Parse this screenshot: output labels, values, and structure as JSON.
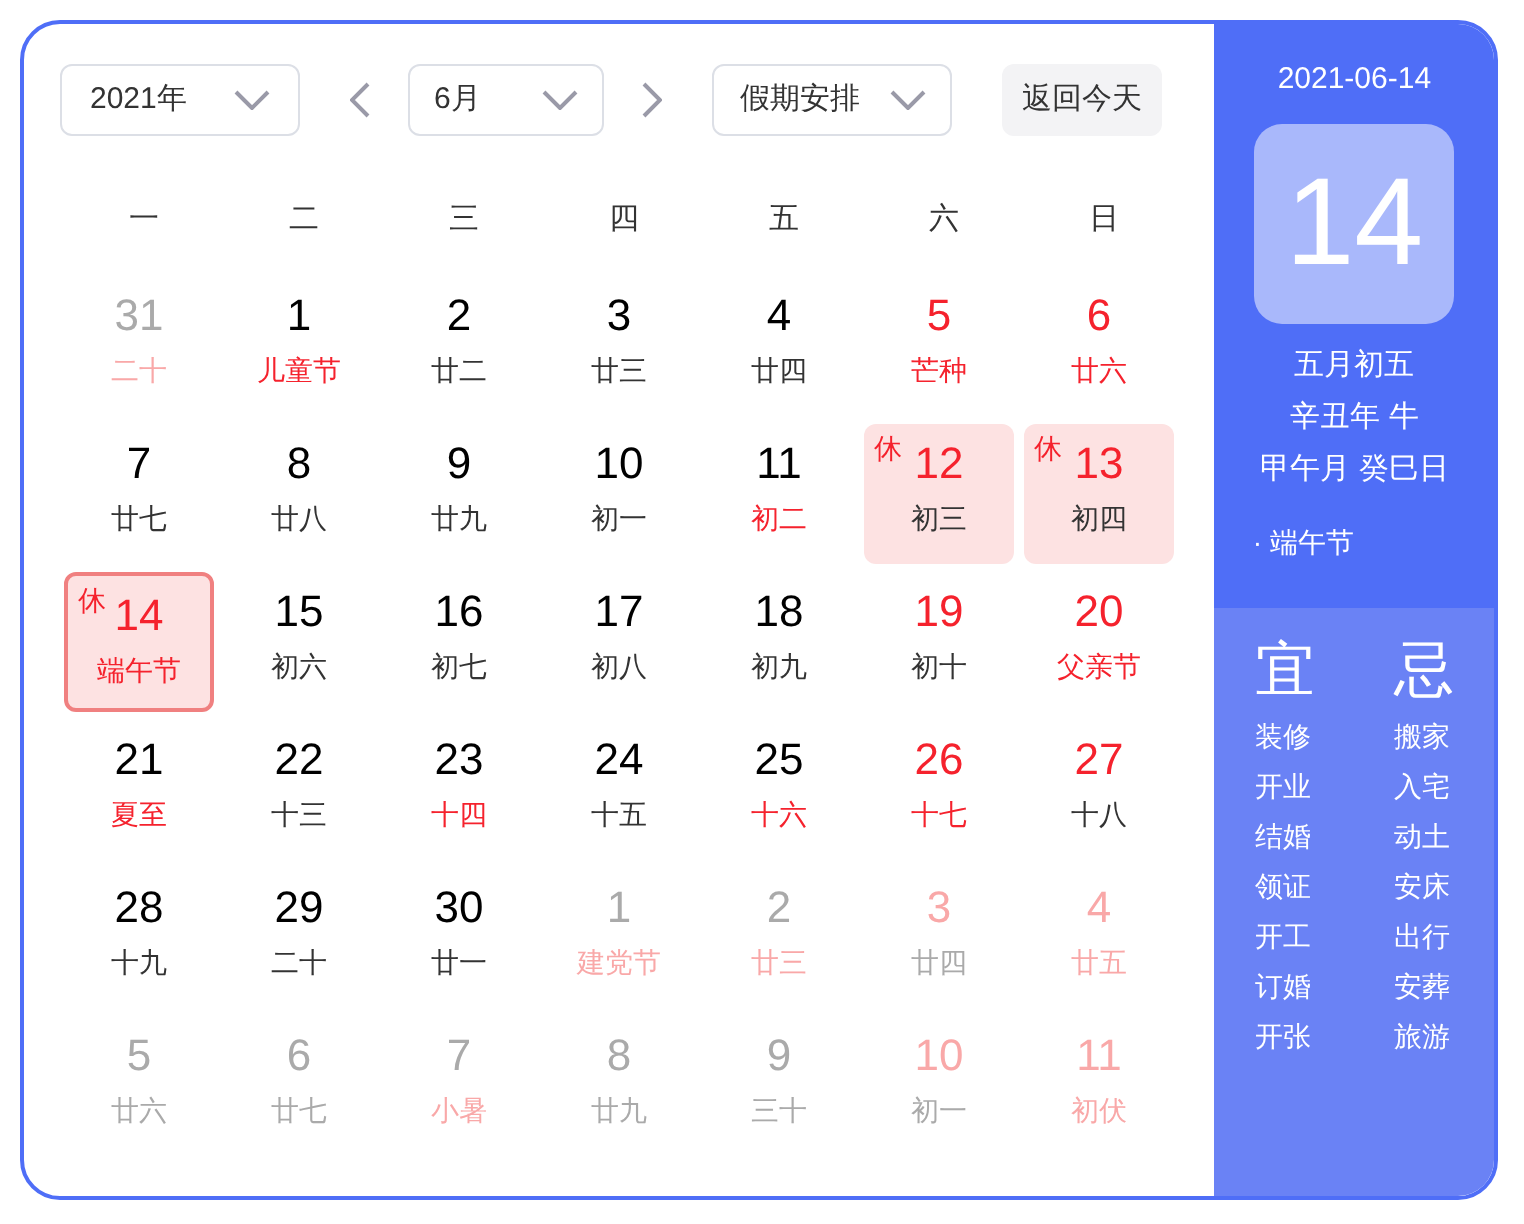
{
  "toolbar": {
    "year": "2021年",
    "month": "6月",
    "holiday": "假期安排",
    "today_button": "返回今天"
  },
  "weekdays": [
    "一",
    "二",
    "三",
    "四",
    "五",
    "六",
    "日"
  ],
  "days": [
    {
      "day": "31",
      "lunar": "二十",
      "other_month": true,
      "number_red": false,
      "lunar_red": true,
      "rest": false,
      "selected": false
    },
    {
      "day": "1",
      "lunar": "儿童节",
      "other_month": false,
      "number_red": false,
      "lunar_red": true,
      "rest": false,
      "selected": false
    },
    {
      "day": "2",
      "lunar": "廿二",
      "other_month": false,
      "number_red": false,
      "lunar_red": false,
      "rest": false,
      "selected": false
    },
    {
      "day": "3",
      "lunar": "廿三",
      "other_month": false,
      "number_red": false,
      "lunar_red": false,
      "rest": false,
      "selected": false
    },
    {
      "day": "4",
      "lunar": "廿四",
      "other_month": false,
      "number_red": false,
      "lunar_red": false,
      "rest": false,
      "selected": false
    },
    {
      "day": "5",
      "lunar": "芒种",
      "other_month": false,
      "number_red": true,
      "lunar_red": true,
      "rest": false,
      "selected": false
    },
    {
      "day": "6",
      "lunar": "廿六",
      "other_month": false,
      "number_red": true,
      "lunar_red": true,
      "rest": false,
      "selected": false
    },
    {
      "day": "7",
      "lunar": "廿七",
      "other_month": false,
      "number_red": false,
      "lunar_red": false,
      "rest": false,
      "selected": false
    },
    {
      "day": "8",
      "lunar": "廿八",
      "other_month": false,
      "number_red": false,
      "lunar_red": false,
      "rest": false,
      "selected": false
    },
    {
      "day": "9",
      "lunar": "廿九",
      "other_month": false,
      "number_red": false,
      "lunar_red": false,
      "rest": false,
      "selected": false
    },
    {
      "day": "10",
      "lunar": "初一",
      "other_month": false,
      "number_red": false,
      "lunar_red": false,
      "rest": false,
      "selected": false
    },
    {
      "day": "11",
      "lunar": "初二",
      "other_month": false,
      "number_red": false,
      "lunar_red": true,
      "rest": false,
      "selected": false
    },
    {
      "day": "12",
      "lunar": "初三",
      "other_month": false,
      "number_red": true,
      "lunar_red": false,
      "rest": true,
      "rest_label": "休",
      "selected": false
    },
    {
      "day": "13",
      "lunar": "初四",
      "other_month": false,
      "number_red": true,
      "lunar_red": false,
      "rest": true,
      "rest_label": "休",
      "selected": false
    },
    {
      "day": "14",
      "lunar": "端午节",
      "other_month": false,
      "number_red": true,
      "lunar_red": true,
      "rest": true,
      "rest_label": "休",
      "selected": true
    },
    {
      "day": "15",
      "lunar": "初六",
      "other_month": false,
      "number_red": false,
      "lunar_red": false,
      "rest": false,
      "selected": false
    },
    {
      "day": "16",
      "lunar": "初七",
      "other_month": false,
      "number_red": false,
      "lunar_red": false,
      "rest": false,
      "selected": false
    },
    {
      "day": "17",
      "lunar": "初八",
      "other_month": false,
      "number_red": false,
      "lunar_red": false,
      "rest": false,
      "selected": false
    },
    {
      "day": "18",
      "lunar": "初九",
      "other_month": false,
      "number_red": false,
      "lunar_red": false,
      "rest": false,
      "selected": false
    },
    {
      "day": "19",
      "lunar": "初十",
      "other_month": false,
      "number_red": true,
      "lunar_red": false,
      "rest": false,
      "selected": false
    },
    {
      "day": "20",
      "lunar": "父亲节",
      "other_month": false,
      "number_red": true,
      "lunar_red": true,
      "rest": false,
      "selected": false
    },
    {
      "day": "21",
      "lunar": "夏至",
      "other_month": false,
      "number_red": false,
      "lunar_red": true,
      "rest": false,
      "selected": false
    },
    {
      "day": "22",
      "lunar": "十三",
      "other_month": false,
      "number_red": false,
      "lunar_red": false,
      "rest": false,
      "selected": false
    },
    {
      "day": "23",
      "lunar": "十四",
      "other_month": false,
      "number_red": false,
      "lunar_red": true,
      "rest": false,
      "selected": false
    },
    {
      "day": "24",
      "lunar": "十五",
      "other_month": false,
      "number_red": false,
      "lunar_red": false,
      "rest": false,
      "selected": false
    },
    {
      "day": "25",
      "lunar": "十六",
      "other_month": false,
      "number_red": false,
      "lunar_red": true,
      "rest": false,
      "selected": false
    },
    {
      "day": "26",
      "lunar": "十七",
      "other_month": false,
      "number_red": true,
      "lunar_red": true,
      "rest": false,
      "selected": false
    },
    {
      "day": "27",
      "lunar": "十八",
      "other_month": false,
      "number_red": true,
      "lunar_red": false,
      "rest": false,
      "selected": false
    },
    {
      "day": "28",
      "lunar": "十九",
      "other_month": false,
      "number_red": false,
      "lunar_red": false,
      "rest": false,
      "selected": false
    },
    {
      "day": "29",
      "lunar": "二十",
      "other_month": false,
      "number_red": false,
      "lunar_red": false,
      "rest": false,
      "selected": false
    },
    {
      "day": "30",
      "lunar": "廿一",
      "other_month": false,
      "number_red": false,
      "lunar_red": false,
      "rest": false,
      "selected": false
    },
    {
      "day": "1",
      "lunar": "建党节",
      "other_month": true,
      "number_red": false,
      "lunar_red": true,
      "rest": false,
      "selected": false
    },
    {
      "day": "2",
      "lunar": "廿三",
      "other_month": true,
      "number_red": false,
      "lunar_red": true,
      "rest": false,
      "selected": false
    },
    {
      "day": "3",
      "lunar": "廿四",
      "other_month": true,
      "number_red": true,
      "lunar_red": false,
      "rest": false,
      "selected": false
    },
    {
      "day": "4",
      "lunar": "廿五",
      "other_month": true,
      "number_red": true,
      "lunar_red": true,
      "rest": false,
      "selected": false
    },
    {
      "day": "5",
      "lunar": "廿六",
      "other_month": true,
      "number_red": false,
      "lunar_red": false,
      "rest": false,
      "selected": false
    },
    {
      "day": "6",
      "lunar": "廿七",
      "other_month": true,
      "number_red": false,
      "lunar_red": false,
      "rest": false,
      "selected": false
    },
    {
      "day": "7",
      "lunar": "小暑",
      "other_month": true,
      "number_red": false,
      "lunar_red": true,
      "rest": false,
      "selected": false
    },
    {
      "day": "8",
      "lunar": "廿九",
      "other_month": true,
      "number_red": false,
      "lunar_red": false,
      "rest": false,
      "selected": false
    },
    {
      "day": "9",
      "lunar": "三十",
      "other_month": true,
      "number_red": false,
      "lunar_red": false,
      "rest": false,
      "selected": false
    },
    {
      "day": "10",
      "lunar": "初一",
      "other_month": true,
      "number_red": true,
      "lunar_red": false,
      "rest": false,
      "selected": false
    },
    {
      "day": "11",
      "lunar": "初伏",
      "other_month": true,
      "number_red": true,
      "lunar_red": true,
      "rest": false,
      "selected": false
    }
  ],
  "side": {
    "date": "2021-06-14",
    "day": "14",
    "lunar_lines": [
      "五月初五",
      "辛丑年 牛",
      "甲午月 癸巳日"
    ],
    "festival": "· 端午节",
    "suitable": {
      "title": "宜",
      "items": [
        "装修",
        "开业",
        "结婚",
        "领证",
        "开工",
        "订婚",
        "开张"
      ]
    },
    "avoid": {
      "title": "忌",
      "items": [
        "搬家",
        "入宅",
        "动土",
        "安床",
        "出行",
        "安葬",
        "旅游"
      ]
    }
  }
}
